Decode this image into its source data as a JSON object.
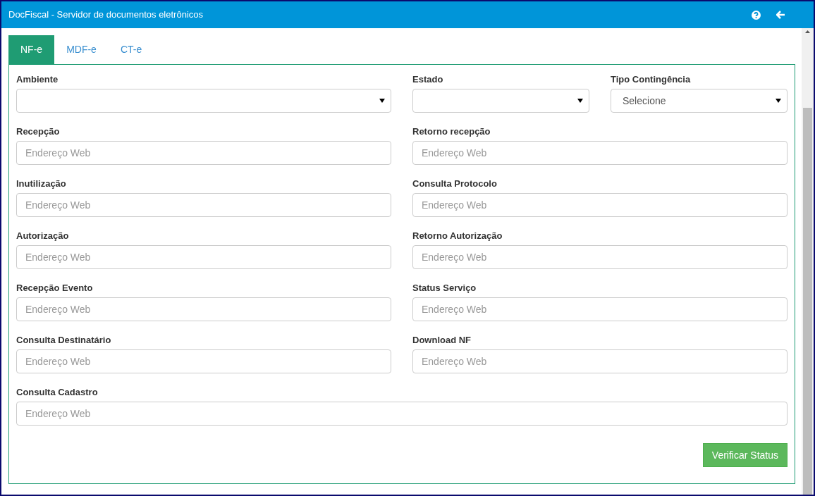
{
  "window": {
    "title": "DocFiscal - Servidor de documentos eletrônicos"
  },
  "tabs": [
    {
      "label": "NF-e",
      "selected": true
    },
    {
      "label": "MDF-e",
      "selected": false
    },
    {
      "label": "CT-e",
      "selected": false
    }
  ],
  "selects": [
    {
      "label": "Ambiente",
      "kind": "wide"
    },
    {
      "label": "Estado",
      "kind": "narrow"
    },
    {
      "label": "Tipo Contingência",
      "kind": "narrow",
      "value": "Selecione"
    }
  ],
  "fields": [
    {
      "label": "Recepção",
      "placeholder": "Endereço Web",
      "kind": "half"
    },
    {
      "label": "Retorno recepção",
      "placeholder": "Endereço Web",
      "kind": "half"
    },
    {
      "label": "Inutilização",
      "placeholder": "Endereço Web",
      "kind": "half"
    },
    {
      "label": "Consulta Protocolo",
      "placeholder": "Endereço Web",
      "kind": "half"
    },
    {
      "label": "Autorização",
      "placeholder": "Endereço Web",
      "kind": "half"
    },
    {
      "label": "Retorno Autorização",
      "placeholder": "Endereço Web",
      "kind": "half"
    },
    {
      "label": "Recepção Evento",
      "placeholder": "Endereço Web",
      "kind": "half"
    },
    {
      "label": "Status Serviço",
      "placeholder": "Endereço Web",
      "kind": "half"
    },
    {
      "label": "Consulta Destinatário",
      "placeholder": "Endereço Web",
      "kind": "half"
    },
    {
      "label": "Download NF",
      "placeholder": "Endereço Web",
      "kind": "half"
    },
    {
      "label": "Consulta Cadastro",
      "placeholder": "Endereço Web",
      "kind": "full"
    }
  ],
  "button": "Verificar Status"
}
